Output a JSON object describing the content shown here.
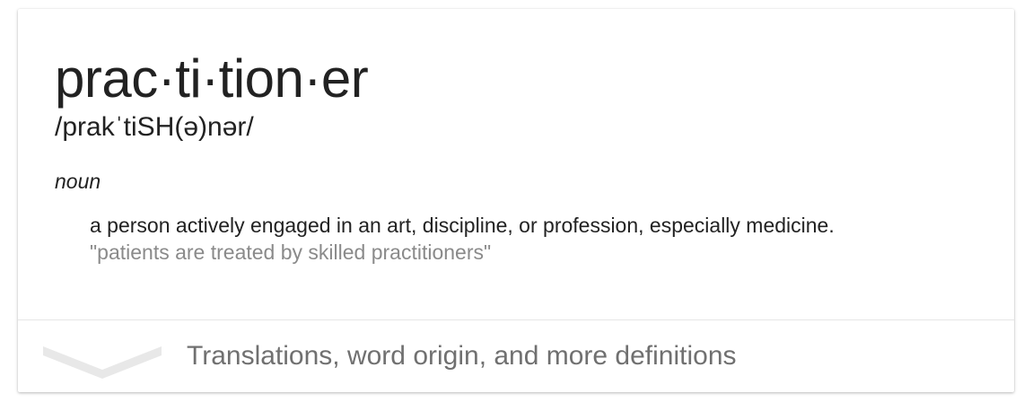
{
  "entry": {
    "word": "prac·ti·tion·er",
    "phonetic": "/prakˈtiSH(ə)nər/",
    "part_of_speech": "noun",
    "definition": "a person actively engaged in an art, discipline, or profession, especially medicine.",
    "example": "\"patients are treated by skilled practitioners\""
  },
  "footer": {
    "more_label": "Translations, word origin, and more definitions",
    "icon": "chevron-down-icon"
  },
  "colors": {
    "text": "#222222",
    "example_text": "#8a8a8a",
    "footer_text": "#707070",
    "chevron": "#e8e8e8"
  }
}
